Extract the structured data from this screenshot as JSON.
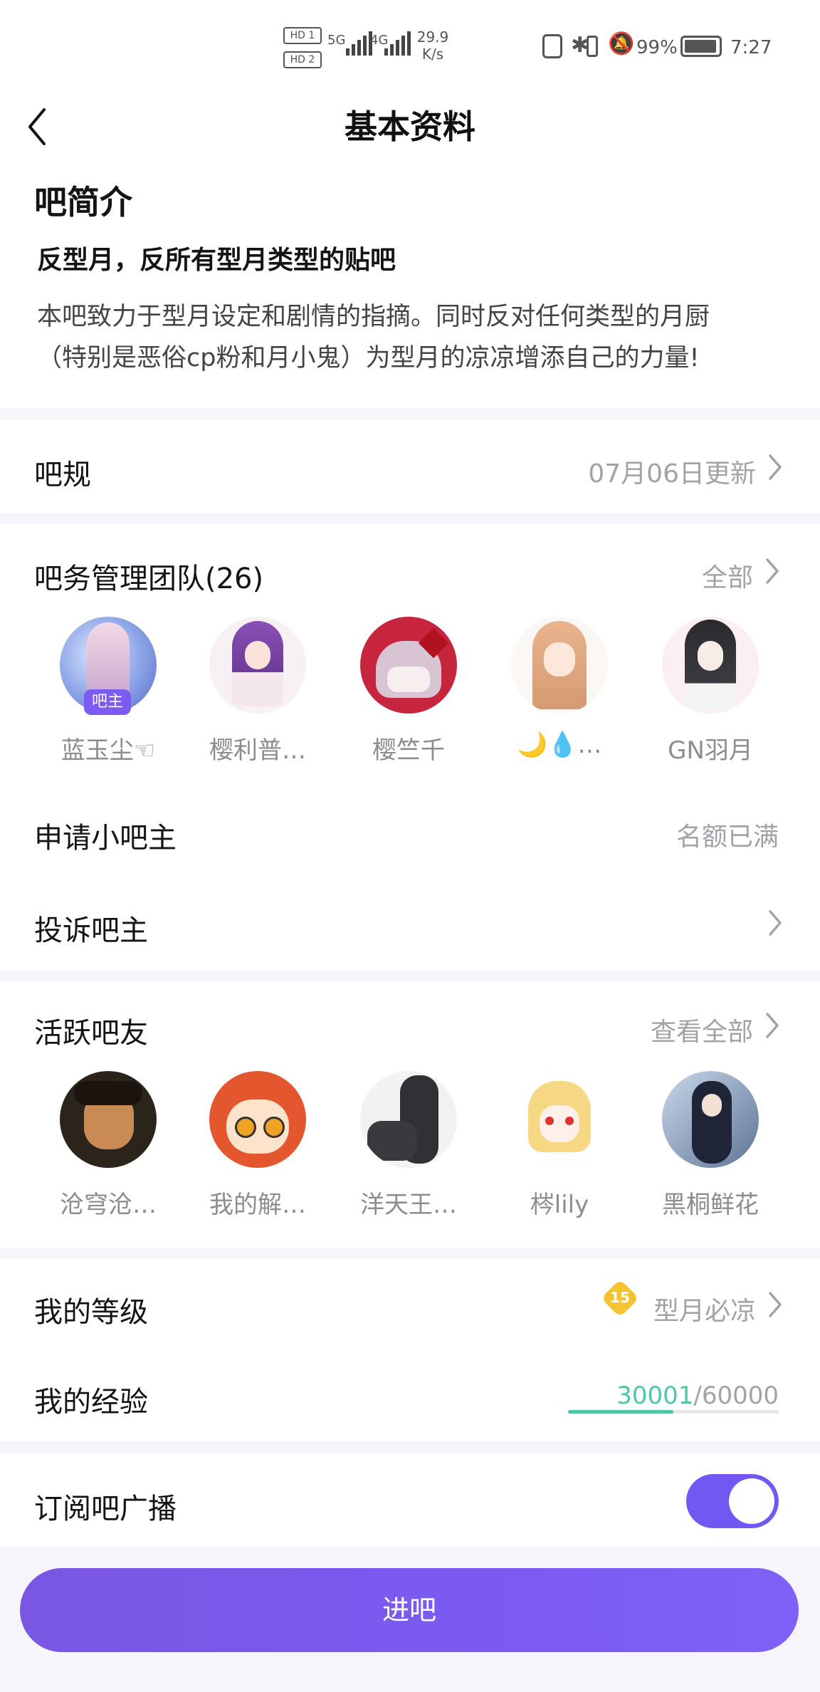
{
  "status_bar": {
    "hd1": "HD 1",
    "hd2": "HD 2",
    "sim1": "5G",
    "sim2": "4G",
    "speed_value": "29.9",
    "speed_unit": "K/s",
    "battery": "99%",
    "time": "7:27"
  },
  "header": {
    "title": "基本资料"
  },
  "intro": {
    "heading": "吧简介",
    "subtitle": "反型月，反所有型月类型的贴吧",
    "desc_line1": "本吧致力于型月设定和剧情的指摘。同时反对任何类型的月厨",
    "desc_line2": "（特别是恶俗cp粉和月小鬼）为型月的凉凉增添自己的力量!"
  },
  "rules": {
    "label": "吧规",
    "updated": "07月06日更新"
  },
  "team": {
    "label": "吧务管理团队(26)",
    "all": "全部",
    "owner_badge": "吧主",
    "members": [
      {
        "name": "蓝玉尘☜"
      },
      {
        "name": "樱利普…"
      },
      {
        "name": "樱竺千"
      },
      {
        "name": "🌙💧…"
      },
      {
        "name": "GN羽月"
      }
    ]
  },
  "apply": {
    "label": "申请小吧主",
    "status": "名额已满"
  },
  "complain": {
    "label": "投诉吧主"
  },
  "active": {
    "label": "活跃吧友",
    "all": "查看全部",
    "members": [
      {
        "name": "沧穹沧…"
      },
      {
        "name": "我的解…"
      },
      {
        "name": "洋天王…"
      },
      {
        "name": "梣lily"
      },
      {
        "name": "黑桐鲜花"
      }
    ]
  },
  "level": {
    "label": "我的等级",
    "badge_num": "15",
    "title": "型月必凉"
  },
  "exp": {
    "label": "我的经验",
    "current": "30001",
    "total": "/60000",
    "progress": 0.5
  },
  "subscribe": {
    "label": "订阅吧广播",
    "enabled": true
  },
  "enter_button": {
    "label": "进吧"
  },
  "colors": {
    "accent": "#7357f2",
    "progress": "#4fc7a4",
    "muted": "#a2a2a8",
    "separator": "#f5f5fb"
  }
}
